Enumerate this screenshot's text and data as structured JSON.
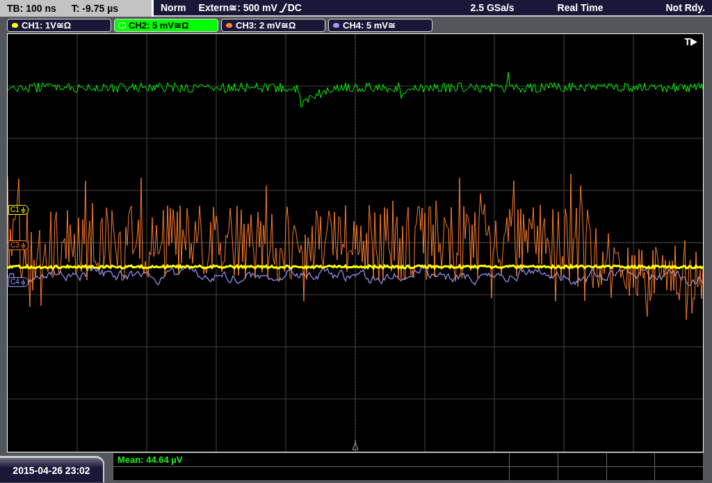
{
  "header": {
    "timebase": "TB: 100 ns",
    "trigger_time": "T: -9.75 µs",
    "mode": "Norm",
    "trigger_source": "Extern≅: 500 mV",
    "coupling": "DC",
    "sample_rate": "2.5 GSa/s",
    "acquisition": "Real Time",
    "status": "Not Rdy."
  },
  "channels": [
    {
      "label": "CH1: 1V≅Ω",
      "color": "#ffff00",
      "selected": false
    },
    {
      "label": "CH2: 5 mV≅Ω",
      "color": "#00ff00",
      "selected": true
    },
    {
      "label": "CH3: 2 mV≅Ω",
      "color": "#ff7f2a",
      "selected": false
    },
    {
      "label": "CH4: 5 mV≅",
      "color": "#9a9aff",
      "selected": false
    }
  ],
  "screen": {
    "trigger_label": "T",
    "markers": [
      {
        "label": "C1",
        "color": "#ffff00"
      },
      {
        "label": "C3",
        "color": "#ff7f2a"
      },
      {
        "label": "C4",
        "color": "#9a9aff"
      }
    ]
  },
  "measurements": {
    "rows": [
      [
        "Mean: 44.64 µV",
        "",
        "",
        "",
        ""
      ]
    ]
  },
  "date": "2015-04-26 23:02"
}
